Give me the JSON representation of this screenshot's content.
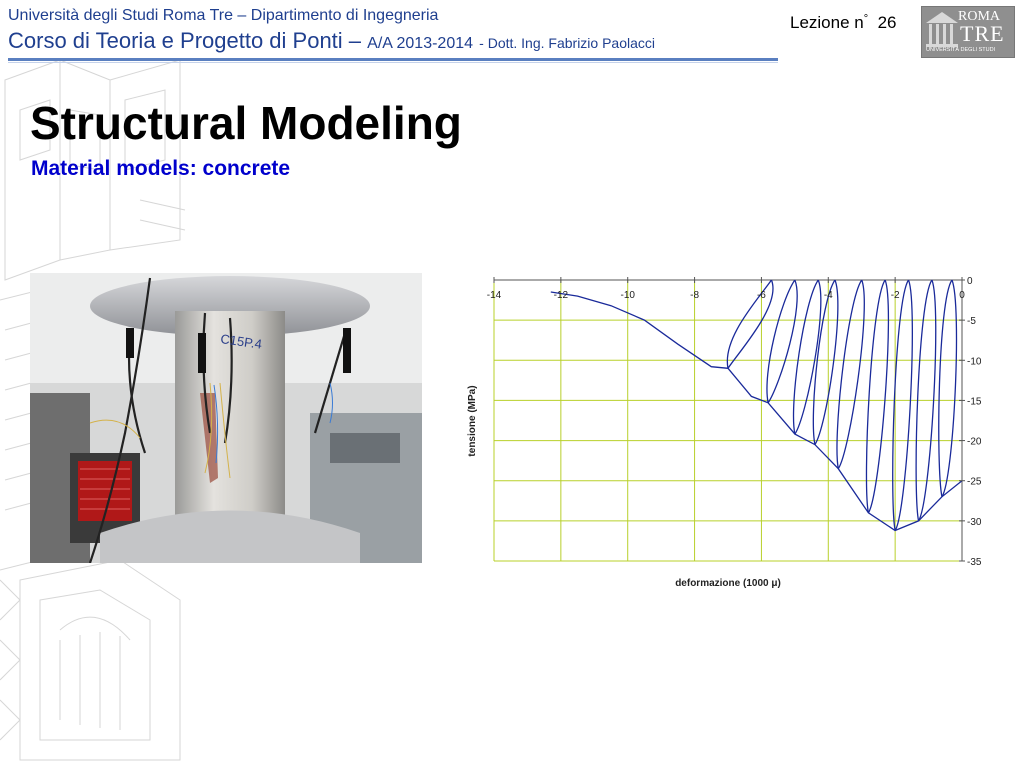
{
  "header": {
    "university": "Università degli Studi Roma Tre – Dipartimento di Ingegneria",
    "course": "Corso di Teoria e Progetto di Ponti –",
    "year": "A/A 2013-2014",
    "teacher": "- Dott. Ing. Fabrizio Paolacci",
    "lesson_label": "Lezione n",
    "lesson_deg": "°",
    "lesson_number": "26"
  },
  "logo": {
    "line1": "ROMA",
    "line2": "TRE",
    "line3": "UNIVERSITÀ DEGLI STUDI"
  },
  "slide": {
    "title": "Structural Modeling",
    "subtitle": "Material models: concrete"
  },
  "photo": {
    "specimen_label": "C15P.4"
  },
  "chart_data": {
    "type": "line",
    "xlabel": "deformazione (1000 μ)",
    "ylabel": "tensione (MPa)",
    "xlim": [
      -14,
      0
    ],
    "ylim": [
      -35,
      0
    ],
    "x_ticks": [
      -14,
      -12,
      -10,
      -8,
      -6,
      -4,
      -2,
      0
    ],
    "y_ticks": [
      0,
      -5,
      -10,
      -15,
      -20,
      -25,
      -30,
      -35
    ],
    "grid": true,
    "line_color": "#1a2a9a",
    "grid_color": "#b8d02a",
    "envelope": {
      "x": [
        -12.3,
        -11.5,
        -10.5,
        -9.5,
        -8.5,
        -7.5,
        -7.0,
        -6.3,
        -5.8,
        -5.0,
        -4.4,
        -3.7,
        -2.8,
        -2.0,
        -1.3,
        -0.6,
        0.0
      ],
      "y": [
        -1.5,
        -2.0,
        -3.2,
        -5.0,
        -8.0,
        -10.8,
        -11.0,
        -14.5,
        -15.3,
        -19.2,
        -20.5,
        -23.5,
        -29.0,
        -31.2,
        -30.0,
        -27.0,
        -25.0
      ]
    },
    "cycles": [
      {
        "peak_x": -7.0,
        "peak_y": -11.0,
        "zero_x": -5.7
      },
      {
        "peak_x": -5.8,
        "peak_y": -15.3,
        "zero_x": -5.0
      },
      {
        "peak_x": -5.0,
        "peak_y": -19.2,
        "zero_x": -4.3
      },
      {
        "peak_x": -4.4,
        "peak_y": -20.5,
        "zero_x": -3.8
      },
      {
        "peak_x": -3.7,
        "peak_y": -23.5,
        "zero_x": -3.0
      },
      {
        "peak_x": -2.8,
        "peak_y": -29.0,
        "zero_x": -2.3
      },
      {
        "peak_x": -2.0,
        "peak_y": -31.2,
        "zero_x": -1.6
      },
      {
        "peak_x": -1.3,
        "peak_y": -30.0,
        "zero_x": -0.9
      },
      {
        "peak_x": -0.6,
        "peak_y": -27.0,
        "zero_x": -0.3
      }
    ]
  }
}
